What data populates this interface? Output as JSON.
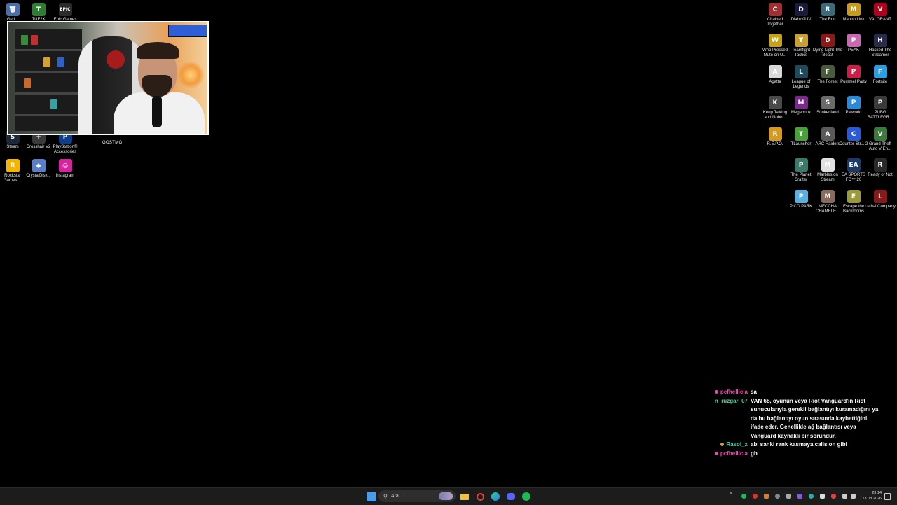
{
  "desktop": {
    "left_icons": [
      {
        "label": "Geri...",
        "icon": "recycle-bin-icon",
        "color": "#4a6ea8",
        "glyph": "🗑"
      },
      {
        "label": "TUF2X",
        "icon": "tuf-icon",
        "color": "#2e7d32",
        "glyph": "T"
      },
      {
        "label": "Epic Games",
        "icon": "epic-games-icon",
        "color": "#2b2b2b",
        "glyph": "EPIC"
      },
      {
        "label": "Steam",
        "icon": "steam-icon",
        "color": "#1b2838",
        "glyph": "S"
      },
      {
        "label": "Crosshair V2",
        "icon": "crosshair-icon",
        "color": "#3a3a3a",
        "glyph": "+"
      },
      {
        "label": "PlayStation® Accessories",
        "icon": "playstation-icon",
        "color": "#0b3d91",
        "glyph": "P"
      },
      {
        "label": "Rockstar Games ...",
        "icon": "rockstar-icon",
        "color": "#f4b400",
        "glyph": "R"
      },
      {
        "label": "CrystalDisk...",
        "icon": "crystaldisk-icon",
        "color": "#5b7fc7",
        "glyph": "◆"
      },
      {
        "label": "Instagram",
        "icon": "instagram-icon",
        "color": "#d6249f",
        "glyph": "◎"
      }
    ],
    "right_icons": [
      {
        "label": "Chained Together",
        "icon": "chained-together-icon",
        "color": "#a03030",
        "glyph": "C"
      },
      {
        "label": "Diablo® IV",
        "icon": "diablo-icon",
        "color": "#1a1a3a",
        "glyph": "D"
      },
      {
        "label": "The Run",
        "icon": "the-run-icon",
        "color": "#3b6a7a",
        "glyph": "R"
      },
      {
        "label": "Maono Link",
        "icon": "maono-link-icon",
        "color": "#c79c1a",
        "glyph": "M"
      },
      {
        "label": "VALORANT",
        "icon": "valorant-icon",
        "color": "#b3001b",
        "glyph": "V"
      },
      {
        "label": "Who Pressed Mute on U...",
        "icon": "who-pressed-mute-icon",
        "color": "#c4a31a",
        "glyph": "W"
      },
      {
        "label": "Teamfight Tactics",
        "icon": "teamfight-tactics-icon",
        "color": "#c8a038",
        "glyph": "T"
      },
      {
        "label": "Dying Light The Beast",
        "icon": "dying-light-icon",
        "color": "#8a1a1a",
        "glyph": "D"
      },
      {
        "label": "PEAK",
        "icon": "peak-icon",
        "color": "#c86ab0",
        "glyph": "P"
      },
      {
        "label": "Hacked The Streamer",
        "icon": "hacked-streamer-icon",
        "color": "#2a2a4a",
        "glyph": "H"
      },
      {
        "label": "Agatta",
        "icon": "agatta-icon",
        "color": "#d8d8d8",
        "glyph": "A"
      },
      {
        "label": "League of Legends",
        "icon": "league-of-legends-icon",
        "color": "#1e4a5a",
        "glyph": "L"
      },
      {
        "label": "The Forest",
        "icon": "the-forest-icon",
        "color": "#4a5a3a",
        "glyph": "F"
      },
      {
        "label": "Pummel Party",
        "icon": "pummel-party-icon",
        "color": "#c8204a",
        "glyph": "P"
      },
      {
        "label": "Fortnite",
        "icon": "fortnite-icon",
        "color": "#2aa0e0",
        "glyph": "F"
      },
      {
        "label": "Keep Talking and Nobo...",
        "icon": "keep-talking-icon",
        "color": "#4a4a4a",
        "glyph": "K"
      },
      {
        "label": "Megabonk",
        "icon": "megabonk-icon",
        "color": "#7a2a8a",
        "glyph": "M"
      },
      {
        "label": "Sunkenland",
        "icon": "sunkenland-icon",
        "color": "#6a6a6a",
        "glyph": "S"
      },
      {
        "label": "Palworld",
        "icon": "palworld-icon",
        "color": "#2a8ad8",
        "glyph": "P"
      },
      {
        "label": "PUBG BATTLEGR...",
        "icon": "pubg-icon",
        "color": "#3a3a3a",
        "glyph": "P"
      },
      {
        "label": "R.E.P.O.",
        "icon": "repo-icon",
        "color": "#d89a1a",
        "glyph": "R"
      },
      {
        "label": "TLauncher",
        "icon": "tlauncher-icon",
        "color": "#4aa03a",
        "glyph": "T"
      },
      {
        "label": "ARC Raiders",
        "icon": "arc-raiders-icon",
        "color": "#5a5a5a",
        "glyph": "A"
      },
      {
        "label": "Counter-Str... 2",
        "icon": "counter-strike-icon",
        "color": "#2a5ad8",
        "glyph": "C"
      },
      {
        "label": "Grand Theft Auto V En...",
        "icon": "gta-v-icon",
        "color": "#3a7a3a",
        "glyph": "V"
      },
      {
        "label": "The Planet Crafter",
        "icon": "planet-crafter-icon",
        "color": "#3a7a6a",
        "glyph": "P"
      },
      {
        "label": "Marbles on Stream",
        "icon": "marbles-icon",
        "color": "#e0e0e0",
        "glyph": "M"
      },
      {
        "label": "EA SPORTS FC™ 26",
        "icon": "ea-fc-icon",
        "color": "#1a3a6a",
        "glyph": "EA"
      },
      {
        "label": "Ready or Not",
        "icon": "ready-or-not-icon",
        "color": "#2a2a2a",
        "glyph": "R"
      },
      {
        "label": "PICO PARK",
        "icon": "pico-park-icon",
        "color": "#5ab0e0",
        "glyph": "P"
      },
      {
        "label": "MECCHA CHAMELE...",
        "icon": "meccha-chameleon-icon",
        "color": "#8a6a5a",
        "glyph": "M"
      },
      {
        "label": "Escape the Backrooms",
        "icon": "escape-backrooms-icon",
        "color": "#9a9a3a",
        "glyph": "E"
      },
      {
        "label": "Lethal Company",
        "icon": "lethal-company-icon",
        "color": "#8a1a1a",
        "glyph": "L"
      }
    ]
  },
  "webcam": {
    "label": "GOSTMG"
  },
  "chat": {
    "messages": [
      {
        "user": "pcfhellicia",
        "user_color": "#e24fa8",
        "badge_color": "#e24fa8",
        "text": "sa"
      },
      {
        "user": "n_ruzgar_07",
        "user_color": "#4fcf9a",
        "badge_color": "",
        "text": "VAN 68, oyunun veya Riot Vanguard'ın Riot sunucularıyla gerekli bağlantıyı kuramadığını ya da bu bağlantıyı oyun sırasında kaybettiğini ifade eder. Genellikle ağ bağlantısı veya Vanguard kaynaklı bir sorundur."
      },
      {
        "user": "Rasol_x",
        "user_color": "#3ad8b0",
        "badge_color": "#d8a030",
        "text": "abi sanki rank kasmaya calisıon gibi"
      },
      {
        "user": "pcfhellicia",
        "user_color": "#e24fa8",
        "badge_color": "#e24fa8",
        "text": "gb"
      }
    ]
  },
  "taskbar": {
    "search_placeholder": "Ara",
    "apps": [
      {
        "icon": "windows-start-icon",
        "color": "#3aa0ff"
      },
      {
        "icon": "file-explorer-icon",
        "color": "#f0c040"
      },
      {
        "icon": "chrome-like-icon",
        "color": "#e04040"
      },
      {
        "icon": "edge-icon",
        "color": "#2aa0e0"
      },
      {
        "icon": "discord-icon",
        "color": "#5865f2"
      },
      {
        "icon": "spotify-icon",
        "color": "#1db954"
      }
    ],
    "clock_time": "23:14",
    "clock_date": "13.08.2026"
  }
}
